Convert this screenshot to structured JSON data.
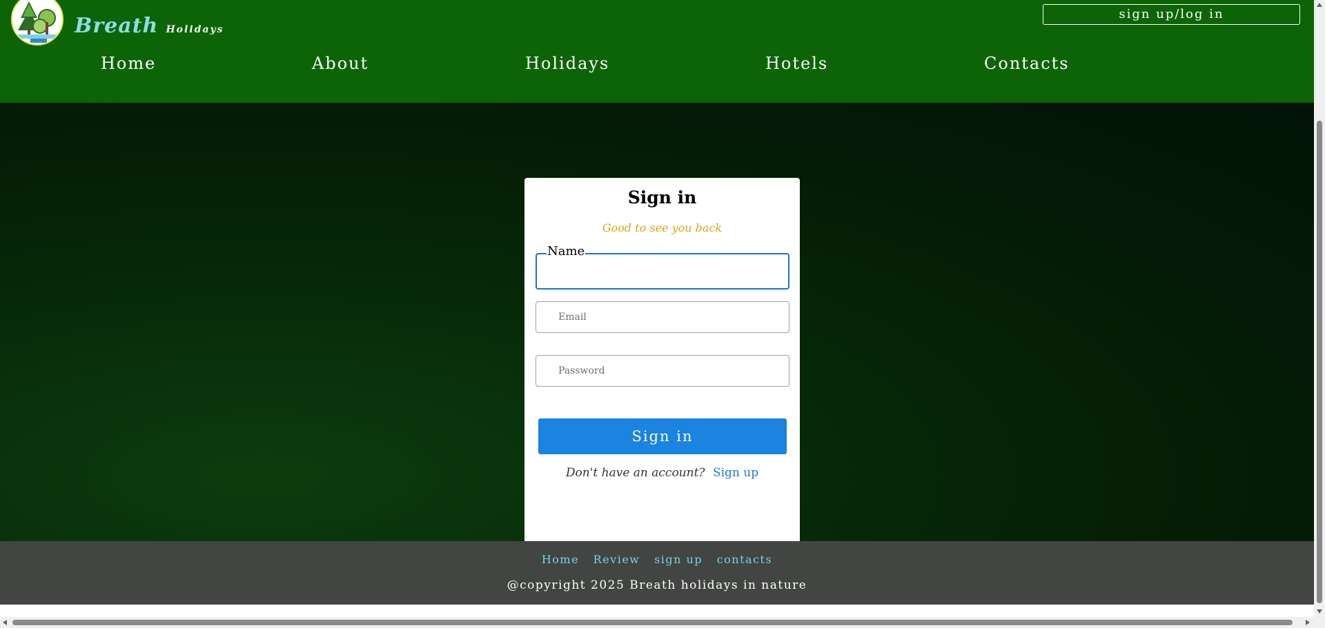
{
  "header": {
    "brand_main": "Breath",
    "brand_sub": "Holidays",
    "auth_button": "sign up/log in",
    "logo_icon": "tree-logo-icon"
  },
  "nav": {
    "items": [
      {
        "label": "Home"
      },
      {
        "label": "About"
      },
      {
        "label": "Holidays"
      },
      {
        "label": "Hotels"
      },
      {
        "label": "Contacts"
      }
    ]
  },
  "form": {
    "title": "Sign in",
    "subtitle": "Good to see you back",
    "name_label": "Name",
    "name_value": "",
    "email_placeholder": "Email",
    "password_placeholder": "Password",
    "submit_label": "Sign in",
    "prompt_text": "Don't have an account?",
    "prompt_link": "Sign up"
  },
  "footer": {
    "links": [
      "Home",
      "Review",
      "sign up",
      "contacts"
    ],
    "copyright": "@copyright 2025 Breath holidays in nature"
  },
  "colors": {
    "header_bg": "#0d6407",
    "accent_button": "#1b83e0",
    "subtitle_gold": "#d4a710",
    "footer_bg": "#424542",
    "footer_link": "#6fd6ea"
  }
}
